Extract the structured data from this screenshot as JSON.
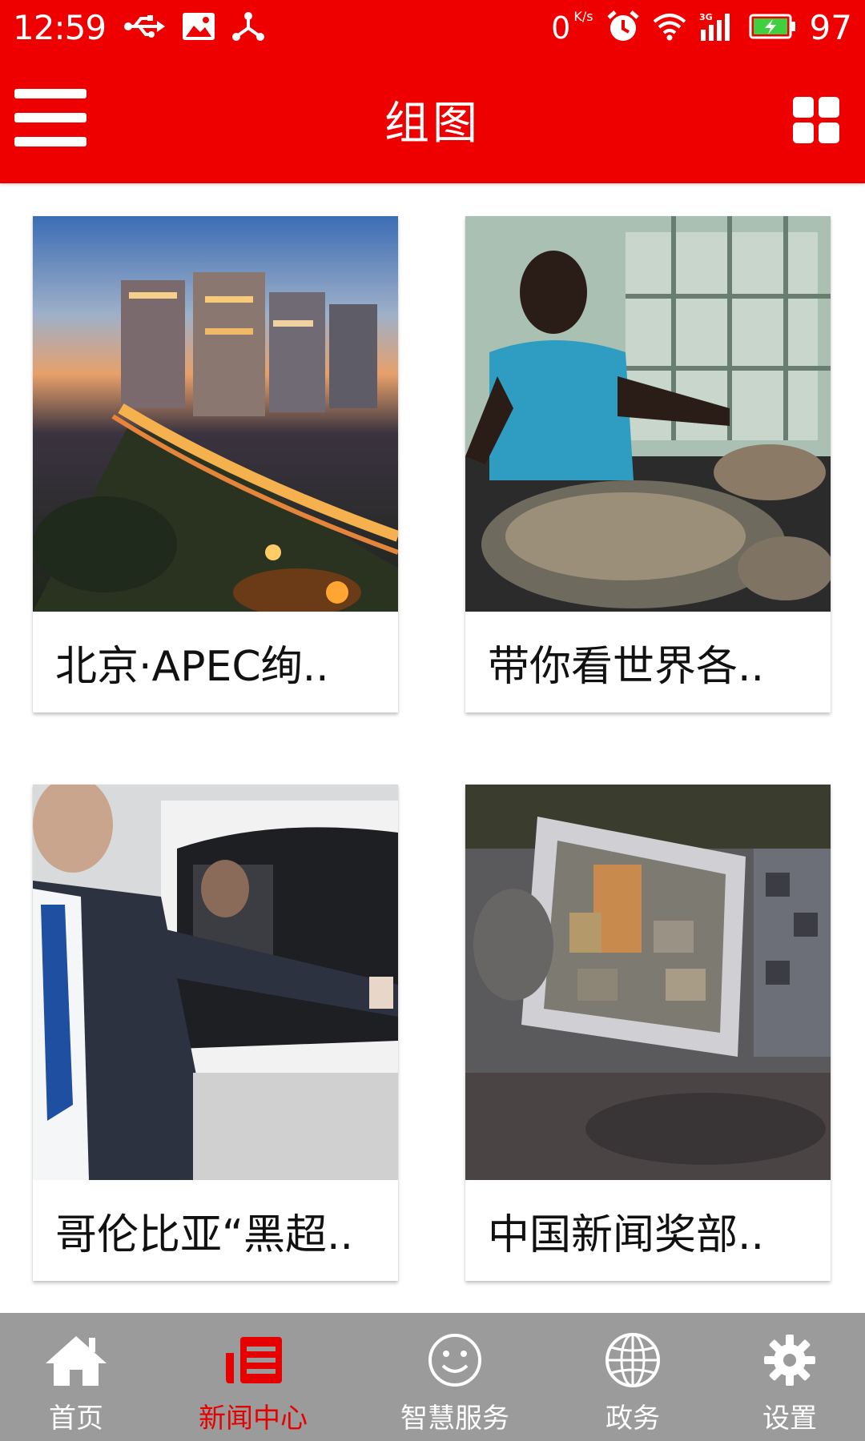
{
  "status_bar": {
    "time": "12:59",
    "left_icons": [
      "usb-icon",
      "image-icon",
      "share-icon"
    ],
    "net_speed_value": "0",
    "net_speed_unit": "K/s",
    "right_icons": [
      "alarm-icon",
      "wifi-icon",
      "signal-3g-icon",
      "battery-charging-icon"
    ],
    "battery_percent": "97"
  },
  "app_bar": {
    "title": "组图",
    "menu_icon": "hamburger-menu-icon",
    "grid_icon": "grid-view-icon"
  },
  "gallery": {
    "items": [
      {
        "title": "北京·APEC绚..",
        "image": "beijing-night-city-photo"
      },
      {
        "title": "带你看世界各..",
        "image": "man-at-market-photo"
      },
      {
        "title": "哥伦比亚“黑超..",
        "image": "bodyguard-car-photo"
      },
      {
        "title": "中国新闻奖部..",
        "image": "photo-frame-stones-photo"
      }
    ]
  },
  "bottom_nav": {
    "items": [
      {
        "label": "首页",
        "icon": "home-icon",
        "active": false
      },
      {
        "label": "新闻中心",
        "icon": "news-icon",
        "active": true
      },
      {
        "label": "智慧服务",
        "icon": "smiley-icon",
        "active": false
      },
      {
        "label": "政务",
        "icon": "globe-icon",
        "active": false
      },
      {
        "label": "设置",
        "icon": "gear-icon",
        "active": false
      }
    ],
    "active_color": "#e60000",
    "inactive_color": "#ffffff"
  },
  "colors": {
    "primary": "#ee0000",
    "nav_background": "#9b9b9b"
  }
}
